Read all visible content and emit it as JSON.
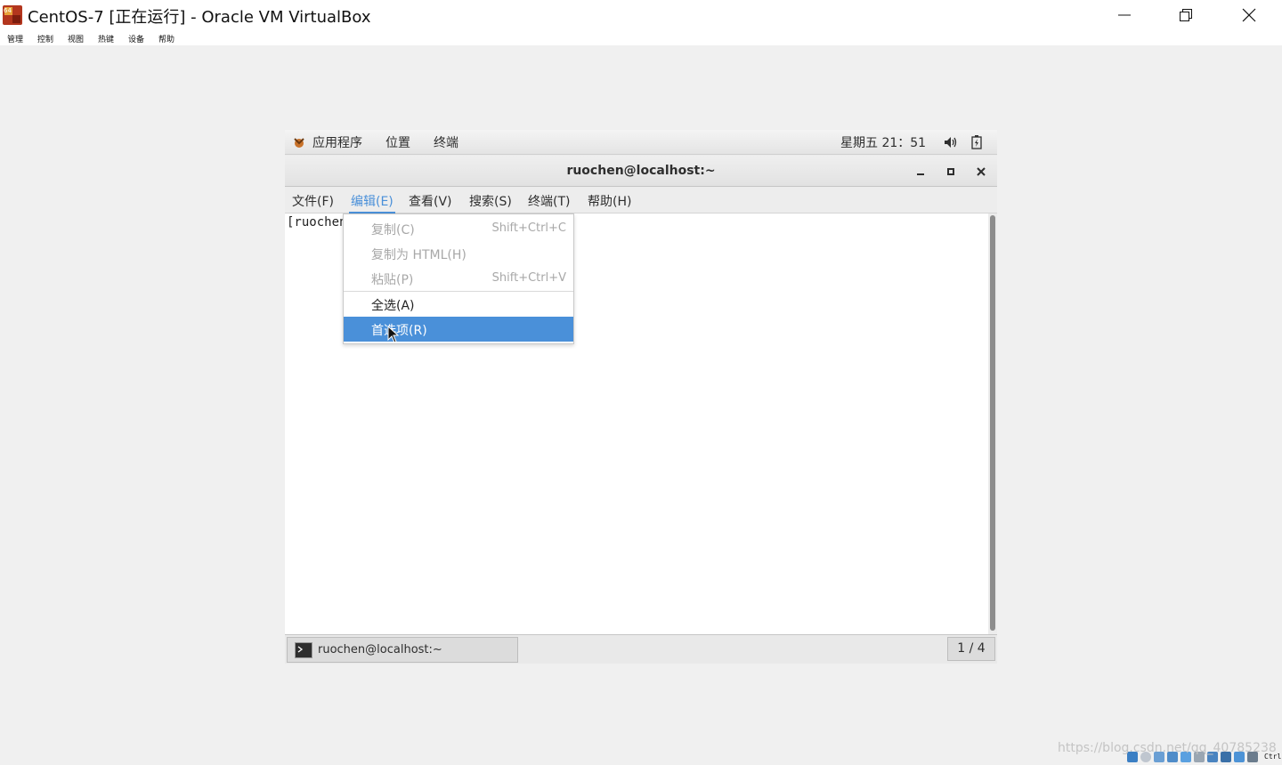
{
  "vbox": {
    "title": "CentOS-7 [正在运行] - Oracle VM VirtualBox",
    "menu": [
      "管理",
      "控制",
      "视图",
      "热键",
      "设备",
      "帮助"
    ],
    "host_key": "Ctrl"
  },
  "gnome_topbar": {
    "applications": "应用程序",
    "places": "位置",
    "terminal": "终端",
    "clock": "星期五 21：51"
  },
  "terminal": {
    "title": "ruochen@localhost:~",
    "menu": [
      "文件(F)",
      "编辑(E)",
      "查看(V)",
      "搜索(S)",
      "终端(T)",
      "帮助(H)"
    ],
    "active_menu": "编辑(E)",
    "prompt_text": "[ruochen"
  },
  "edit_menu": {
    "items": [
      {
        "label": "复制(C)",
        "accelerator": "Shift+Ctrl+C",
        "enabled": false
      },
      {
        "label": "复制为 HTML(H)",
        "accelerator": "",
        "enabled": false
      },
      {
        "label": "粘贴(P)",
        "accelerator": "Shift+Ctrl+V",
        "enabled": false
      },
      {
        "label": "全选(A)",
        "accelerator": "",
        "enabled": true
      },
      {
        "label": "首选项(R)",
        "accelerator": "",
        "enabled": true,
        "highlighted": true
      }
    ]
  },
  "taskbar": {
    "window_label": "ruochen@localhost:~",
    "workspace": "1 / 4"
  },
  "watermark": "https://blog.csdn.net/qq_40785238",
  "colors": {
    "highlight": "#4a90d9",
    "disabled_text": "#a8a8a8"
  }
}
